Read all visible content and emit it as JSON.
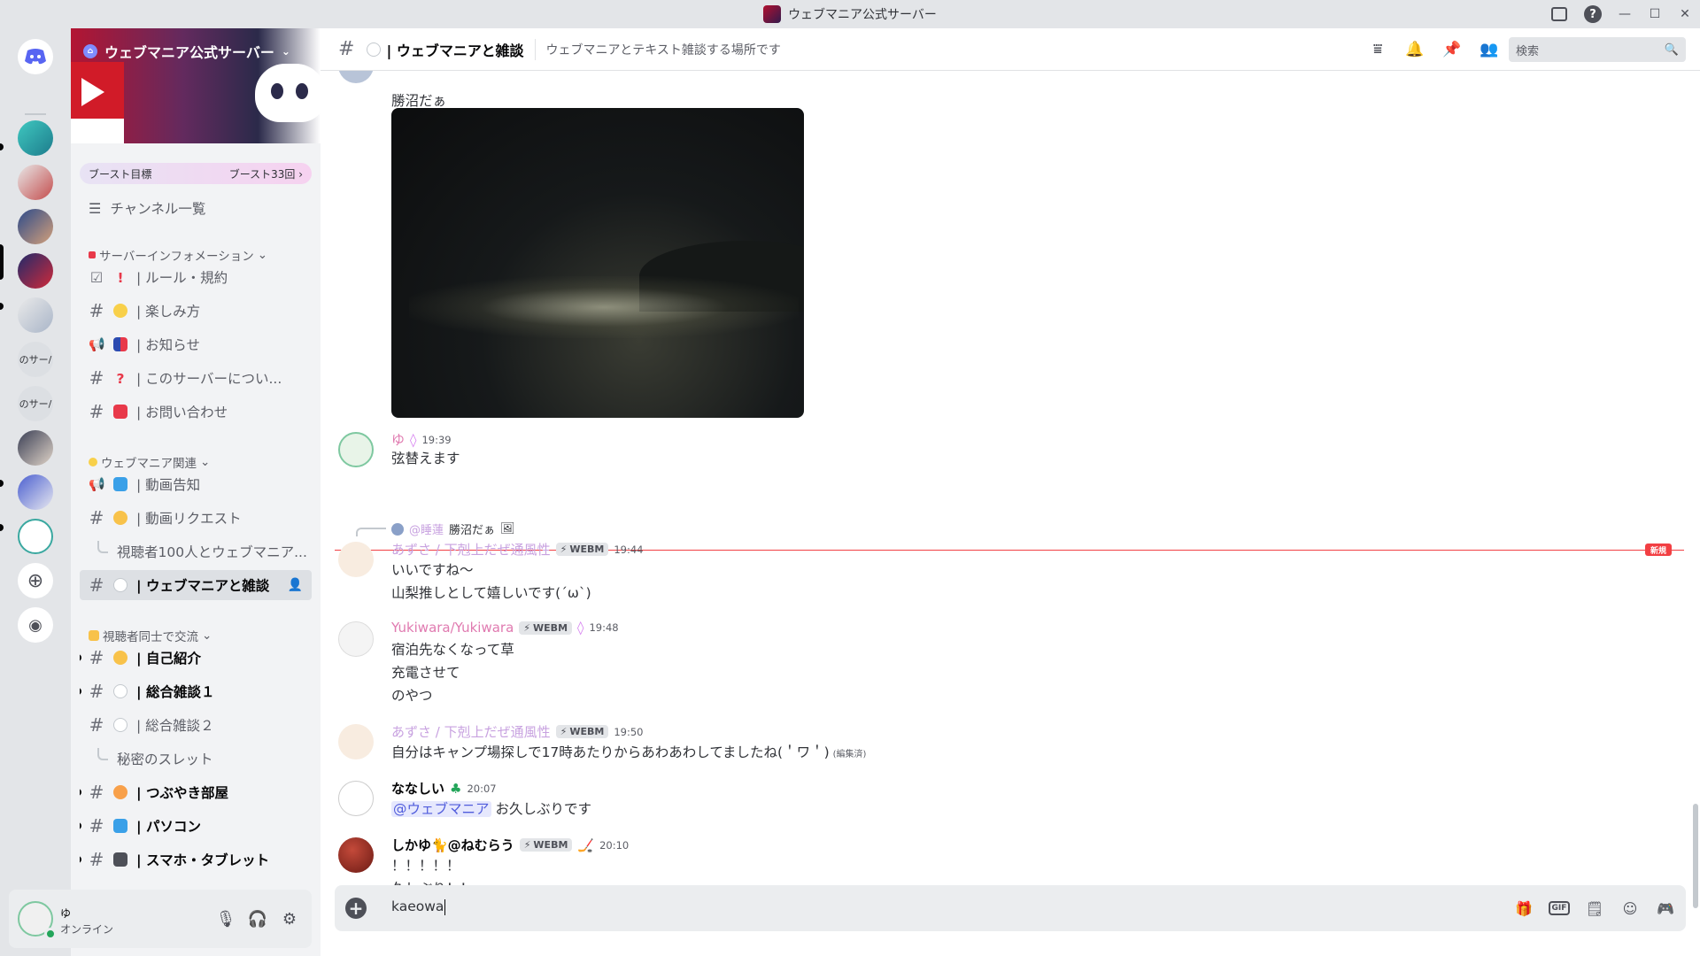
{
  "window": {
    "title": "ウェブマニア公式サーバー"
  },
  "rail": {
    "folders": [
      {
        "label": "のサー/"
      },
      {
        "label": "のサー/"
      }
    ]
  },
  "server": {
    "name": "ウェブマニア公式サーバー",
    "boost_goal": "ブースト目標",
    "boost_count": "ブースト33回",
    "browse_channels": "チャンネル一覧"
  },
  "categories": [
    {
      "label": "サーバーインフォメーション"
    },
    {
      "label": "ウェブマニア関連"
    },
    {
      "label": "視聴者同士で交流"
    }
  ],
  "channels": [
    {
      "label": "| ルール・規約"
    },
    {
      "label": "| 楽しみ方"
    },
    {
      "label": "| お知らせ"
    },
    {
      "label": "| このサーバーについ..."
    },
    {
      "label": "| お問い合わせ"
    },
    {
      "label": "| 動画告知"
    },
    {
      "label": "| 動画リクエスト"
    },
    {
      "label": "視聴者100人とウェブマニア..."
    },
    {
      "label": "| ウェブマニアと雑談"
    },
    {
      "label": "| 自己紹介"
    },
    {
      "label": "| 総合雑談１"
    },
    {
      "label": "| 総合雑談２"
    },
    {
      "label": "秘密のスレット"
    },
    {
      "label": "| つぶやき部屋"
    },
    {
      "label": "| パソコン"
    },
    {
      "label": "| スマホ・タブレット"
    }
  ],
  "header": {
    "channel": "| ウェブマニアと雑談",
    "topic": "ウェブマニアとテキスト雑談する場所です",
    "search_placeholder": "検索"
  },
  "messages": {
    "m0": {
      "text": "勝沼だぁ"
    },
    "m1": {
      "author": "ゆ",
      "time": "19:39",
      "text": "弦替えます"
    },
    "new_label": "新規",
    "m2": {
      "reply_author": "@睡蓮",
      "reply_text": "勝沼だぁ",
      "author": "あずさ / 下剋上だぜ通風性",
      "tag": "WEBM",
      "time": "19:44",
      "lines": [
        "いいですね～",
        "山梨推しとして嬉しいです(´ω`)"
      ]
    },
    "m3": {
      "author": "Yukiwara/Yukiwara",
      "tag": "WEBM",
      "time": "19:48",
      "lines": [
        "宿泊先なくなって草",
        "充電させて",
        "のやつ"
      ]
    },
    "m4": {
      "author": "あずさ / 下剋上だぜ通風性",
      "tag": "WEBM",
      "time": "19:50",
      "text": "自分はキャンプ場探しで17時あたりからあわあわしてましたね(＇ワ＇)",
      "edited": "(編集済)"
    },
    "m5": {
      "author": "ななしい",
      "time": "20:07",
      "mention": "@ウェブマニア",
      "text": "お久しぶりです"
    },
    "m6": {
      "author": "しかゆ🐈@ねむらう",
      "tag": "WEBM",
      "time": "20:10",
      "lines": [
        "！！！！！",
        "久しぶり！！"
      ]
    }
  },
  "composer": {
    "value": "kaeowa"
  },
  "user": {
    "name": "ゆ",
    "status": "オンライン"
  },
  "colors": {
    "accent": "#5865f2",
    "online": "#23a55a",
    "new_divider": "#f23f43",
    "author_pink": "#e07ab0",
    "author_lavender": "#c8a2e0",
    "author_dark": "#060607"
  }
}
